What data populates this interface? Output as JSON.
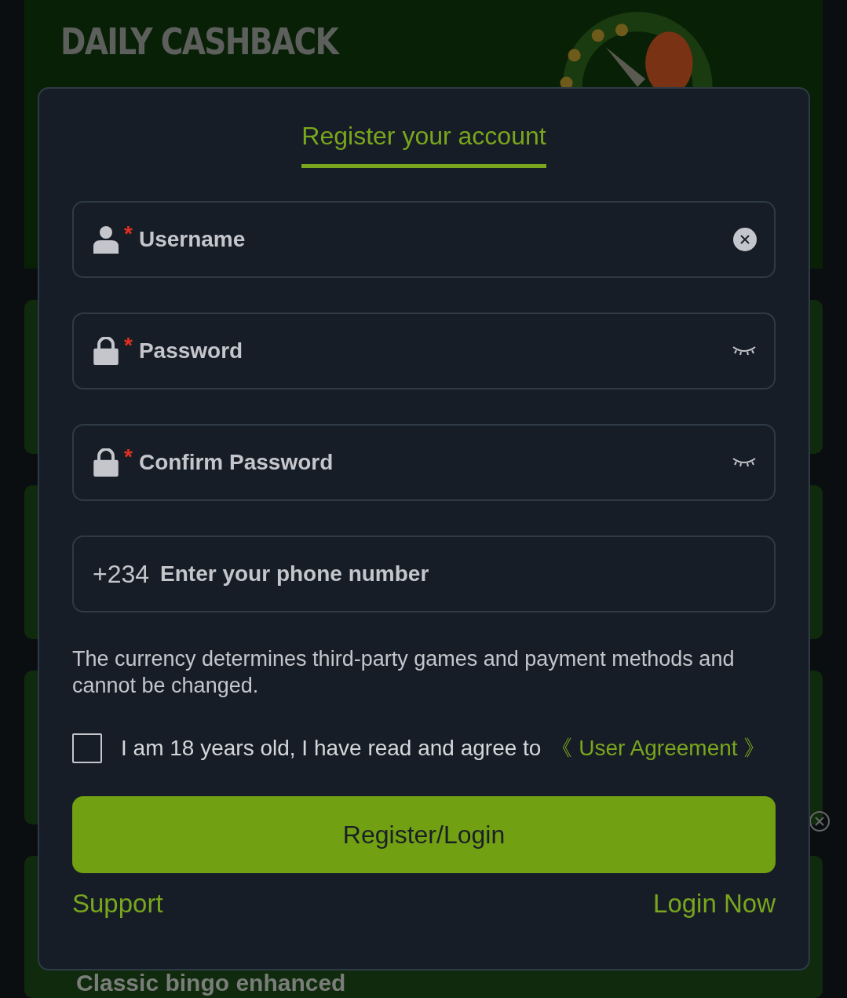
{
  "background": {
    "banner_title": "DAILY CASHBACK",
    "game_caption": "Classic bingo enhanced"
  },
  "dialog": {
    "tabs": [
      {
        "label": "Register your account",
        "selected": true
      }
    ],
    "fields": [
      {
        "kind": "username",
        "required_mark": "*",
        "placeholder": "Username"
      },
      {
        "kind": "password",
        "required_mark": "*",
        "placeholder": "Password"
      },
      {
        "kind": "password",
        "required_mark": "*",
        "placeholder": "Confirm Password"
      },
      {
        "kind": "phone",
        "prefix": "+234",
        "placeholder": "Enter your phone number"
      }
    ],
    "notice": "The currency determines third-party games and payment methods and cannot be changed.",
    "agreement": {
      "checked": false,
      "text": "I am 18 years old, I have read and agree to",
      "link": "《 User Agreement 》"
    },
    "submit": "Register/Login",
    "links": [
      "Support",
      "Login Now"
    ]
  }
}
